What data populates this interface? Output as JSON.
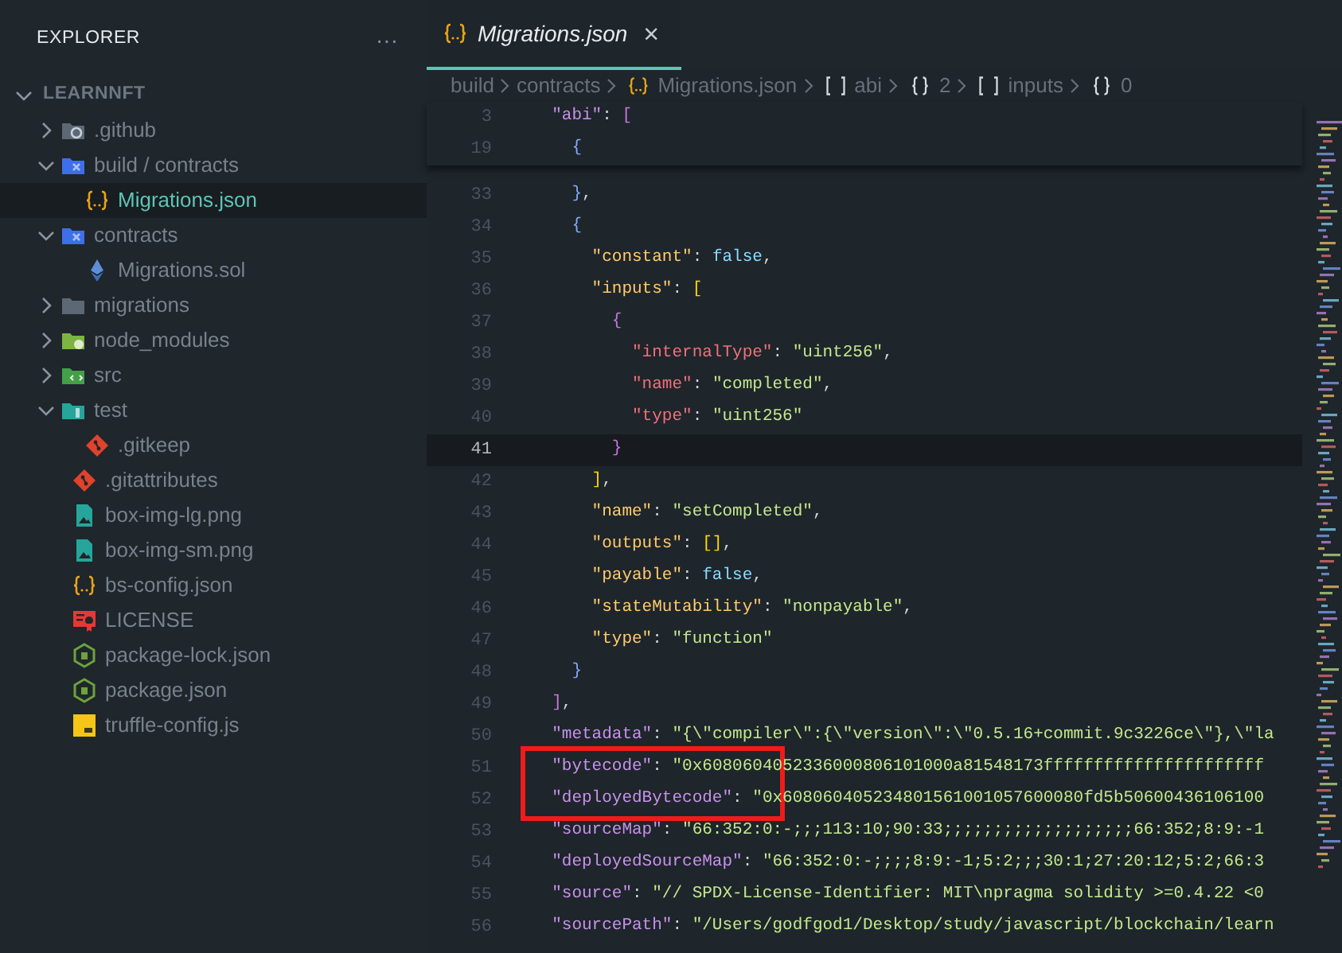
{
  "sidebar": {
    "title": "EXPLORER",
    "more_button": "···",
    "root": {
      "label": "LEARNNFT",
      "expanded": true,
      "children": [
        {
          "label": ".github",
          "kind": "folder_github",
          "expanded": false,
          "selected": false
        },
        {
          "label": "build / contracts",
          "kind": "folder_build",
          "expanded": true,
          "selected": false,
          "children": [
            {
              "label": "Migrations.json",
              "kind": "file_json",
              "selected": true
            }
          ]
        },
        {
          "label": "contracts",
          "kind": "folder_build",
          "expanded": true,
          "selected": false,
          "children": [
            {
              "label": "Migrations.sol",
              "kind": "file_sol",
              "selected": false
            }
          ]
        },
        {
          "label": "migrations",
          "kind": "folder_plain",
          "expanded": false,
          "selected": false
        },
        {
          "label": "node_modules",
          "kind": "folder_node",
          "expanded": false,
          "selected": false
        },
        {
          "label": "src",
          "kind": "folder_src",
          "expanded": false,
          "selected": false
        },
        {
          "label": "test",
          "kind": "folder_test",
          "expanded": true,
          "selected": false,
          "children": [
            {
              "label": ".gitkeep",
              "kind": "file_git",
              "selected": false
            }
          ]
        },
        {
          "label": ".gitattributes",
          "kind": "file_git",
          "selected": false
        },
        {
          "label": "box-img-lg.png",
          "kind": "file_image",
          "selected": false
        },
        {
          "label": "box-img-sm.png",
          "kind": "file_image",
          "selected": false
        },
        {
          "label": "bs-config.json",
          "kind": "file_json",
          "selected": false
        },
        {
          "label": "LICENSE",
          "kind": "file_license",
          "selected": false
        },
        {
          "label": "package-lock.json",
          "kind": "file_node",
          "selected": false
        },
        {
          "label": "package.json",
          "kind": "file_node",
          "selected": false
        },
        {
          "label": "truffle-config.js",
          "kind": "file_js",
          "selected": false
        }
      ]
    }
  },
  "tabs": [
    {
      "label": "Migrations.json",
      "kind": "file_json",
      "selected": true,
      "preview": true,
      "close": "×"
    }
  ],
  "breadcrumb": [
    {
      "label": "build",
      "kind": "plain"
    },
    {
      "label": "contracts",
      "kind": "plain"
    },
    {
      "label": "Migrations.json",
      "kind": "json"
    },
    {
      "label": "abi",
      "kind": "array"
    },
    {
      "label": "2",
      "kind": "object"
    },
    {
      "label": "inputs",
      "kind": "array"
    },
    {
      "label": "0",
      "kind": "object"
    }
  ],
  "sticky_lines": [
    {
      "number": "3",
      "tokens": [
        {
          "kind": "key_top",
          "text": "  \"abi\""
        },
        {
          "kind": "punct",
          "text": ": "
        },
        {
          "kind": "bracket_a",
          "text": "["
        }
      ]
    },
    {
      "number": "19",
      "tokens": [
        {
          "kind": "bracket_b",
          "text": "    {"
        }
      ]
    }
  ],
  "lines": [
    {
      "number": "33",
      "current": false,
      "tokens": [
        {
          "kind": "bracket_b",
          "text": "    }"
        },
        {
          "kind": "punct",
          "text": ","
        }
      ]
    },
    {
      "number": "34",
      "current": false,
      "tokens": [
        {
          "kind": "bracket_b",
          "text": "    {"
        }
      ]
    },
    {
      "number": "35",
      "current": false,
      "tokens": [
        {
          "kind": "key_item",
          "text": "      \"constant\""
        },
        {
          "kind": "punct",
          "text": ": "
        },
        {
          "kind": "literal",
          "text": "false"
        },
        {
          "kind": "punct",
          "text": ","
        }
      ]
    },
    {
      "number": "36",
      "current": false,
      "tokens": [
        {
          "kind": "key_item",
          "text": "      \"inputs\""
        },
        {
          "kind": "punct",
          "text": ": "
        },
        {
          "kind": "bracket_c",
          "text": "["
        }
      ]
    },
    {
      "number": "37",
      "current": false,
      "tokens": [
        {
          "kind": "bracket_a",
          "text": "        {"
        }
      ]
    },
    {
      "number": "38",
      "current": false,
      "tokens": [
        {
          "kind": "key_param",
          "text": "          \"internalType\""
        },
        {
          "kind": "punct",
          "text": ": "
        },
        {
          "kind": "string",
          "text": "\"uint256\""
        },
        {
          "kind": "punct",
          "text": ","
        }
      ]
    },
    {
      "number": "39",
      "current": false,
      "tokens": [
        {
          "kind": "key_param",
          "text": "          \"name\""
        },
        {
          "kind": "punct",
          "text": ": "
        },
        {
          "kind": "string",
          "text": "\"completed\""
        },
        {
          "kind": "punct",
          "text": ","
        }
      ]
    },
    {
      "number": "40",
      "current": false,
      "tokens": [
        {
          "kind": "key_param",
          "text": "          \"type\""
        },
        {
          "kind": "punct",
          "text": ": "
        },
        {
          "kind": "string",
          "text": "\"uint256\""
        }
      ]
    },
    {
      "number": "41",
      "current": true,
      "tokens": [
        {
          "kind": "bracket_a",
          "text": "        }"
        }
      ]
    },
    {
      "number": "42",
      "current": false,
      "tokens": [
        {
          "kind": "bracket_c",
          "text": "      ]"
        },
        {
          "kind": "punct",
          "text": ","
        }
      ]
    },
    {
      "number": "43",
      "current": false,
      "tokens": [
        {
          "kind": "key_item",
          "text": "      \"name\""
        },
        {
          "kind": "punct",
          "text": ": "
        },
        {
          "kind": "string",
          "text": "\"setCompleted\""
        },
        {
          "kind": "punct",
          "text": ","
        }
      ]
    },
    {
      "number": "44",
      "current": false,
      "tokens": [
        {
          "kind": "key_item",
          "text": "      \"outputs\""
        },
        {
          "kind": "punct",
          "text": ": "
        },
        {
          "kind": "bracket_c",
          "text": "[]"
        },
        {
          "kind": "punct",
          "text": ","
        }
      ]
    },
    {
      "number": "45",
      "current": false,
      "tokens": [
        {
          "kind": "key_item",
          "text": "      \"payable\""
        },
        {
          "kind": "punct",
          "text": ": "
        },
        {
          "kind": "literal",
          "text": "false"
        },
        {
          "kind": "punct",
          "text": ","
        }
      ]
    },
    {
      "number": "46",
      "current": false,
      "tokens": [
        {
          "kind": "key_item",
          "text": "      \"stateMutability\""
        },
        {
          "kind": "punct",
          "text": ": "
        },
        {
          "kind": "string",
          "text": "\"nonpayable\""
        },
        {
          "kind": "punct",
          "text": ","
        }
      ]
    },
    {
      "number": "47",
      "current": false,
      "tokens": [
        {
          "kind": "key_item",
          "text": "      \"type\""
        },
        {
          "kind": "punct",
          "text": ": "
        },
        {
          "kind": "string",
          "text": "\"function\""
        }
      ]
    },
    {
      "number": "48",
      "current": false,
      "tokens": [
        {
          "kind": "bracket_b",
          "text": "    }"
        }
      ]
    },
    {
      "number": "49",
      "current": false,
      "tokens": [
        {
          "kind": "bracket_a",
          "text": "  ]"
        },
        {
          "kind": "punct",
          "text": ","
        }
      ]
    },
    {
      "number": "50",
      "current": false,
      "tokens": [
        {
          "kind": "key_top",
          "text": "  \"metadata\""
        },
        {
          "kind": "punct",
          "text": ": "
        },
        {
          "kind": "string",
          "text": "\"{\\\"compiler\\\":{\\\"version\\\":\\\"0.5.16+commit.9c3226ce\\\"},\\\"la"
        }
      ]
    },
    {
      "number": "51",
      "current": false,
      "tokens": [
        {
          "kind": "key_top",
          "text": "  \"bytecode\""
        },
        {
          "kind": "punct",
          "text": ": "
        },
        {
          "kind": "string",
          "text": "\"0x6080604052336000806101000a81548173ffffffffffffffffffffff"
        }
      ]
    },
    {
      "number": "52",
      "current": false,
      "tokens": [
        {
          "kind": "key_top",
          "text": "  \"deployedBytecode\""
        },
        {
          "kind": "punct",
          "text": ": "
        },
        {
          "kind": "string",
          "text": "\"0x608060405234801561001057600080fd5b50600436106100"
        }
      ]
    },
    {
      "number": "53",
      "current": false,
      "tokens": [
        {
          "kind": "key_top",
          "text": "  \"sourceMap\""
        },
        {
          "kind": "punct",
          "text": ": "
        },
        {
          "kind": "string",
          "text": "\"66:352:0:-;;;113:10;90:33;;;;;;;;;;;;;;;;;;;66:352;8:9:-1"
        }
      ]
    },
    {
      "number": "54",
      "current": false,
      "tokens": [
        {
          "kind": "key_top",
          "text": "  \"deployedSourceMap\""
        },
        {
          "kind": "punct",
          "text": ": "
        },
        {
          "kind": "string",
          "text": "\"66:352:0:-;;;;8:9:-1;5:2;;;30:1;27:20:12;5:2;66:3"
        }
      ]
    },
    {
      "number": "55",
      "current": false,
      "tokens": [
        {
          "kind": "key_top",
          "text": "  \"source\""
        },
        {
          "kind": "punct",
          "text": ": "
        },
        {
          "kind": "string",
          "text": "\"// SPDX-License-Identifier: MIT\\npragma solidity >=0.4.22 <0"
        }
      ]
    },
    {
      "number": "56",
      "current": false,
      "tokens": [
        {
          "kind": "key_top",
          "text": "  \"sourcePath\""
        },
        {
          "kind": "punct",
          "text": ": "
        },
        {
          "kind": "string",
          "text": "\"/Users/godfgod1/Desktop/study/javascript/blockchain/learn"
        }
      ]
    }
  ],
  "highlight_box": true
}
